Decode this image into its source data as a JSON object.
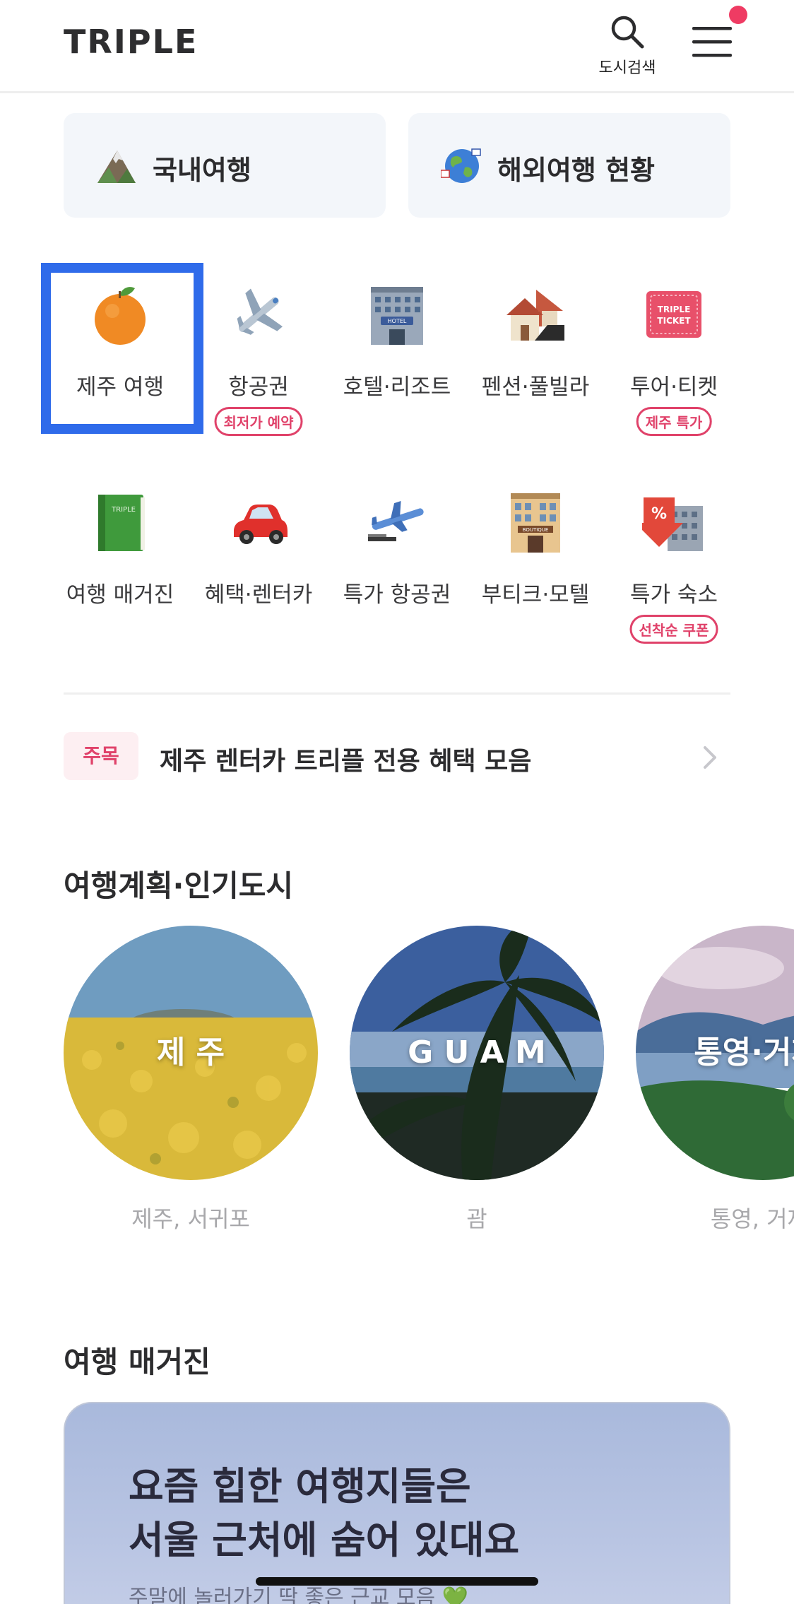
{
  "header": {
    "logo": "TRIPLE",
    "search_label": "도시검색",
    "menu_icon": "hamburger-menu-icon",
    "notification_color": "#ef3b63"
  },
  "top_cards": [
    {
      "label": "국내여행",
      "icon": "mountain-icon"
    },
    {
      "label": "해외여행 현황",
      "icon": "globe-icon"
    }
  ],
  "categories": [
    {
      "label": "제주 여행",
      "icon": "tangerine-icon",
      "selected": true
    },
    {
      "label": "항공권",
      "icon": "airplane-icon",
      "badge": "최저가 예약"
    },
    {
      "label": "호텔·리조트",
      "icon": "hotel-icon"
    },
    {
      "label": "펜션·풀빌라",
      "icon": "houses-icon"
    },
    {
      "label": "투어·티켓",
      "icon": "ticket-icon",
      "badge": "제주 특가"
    },
    {
      "label": "여행 매거진",
      "icon": "magazine-book-icon"
    },
    {
      "label": "혜택·렌터카",
      "icon": "car-icon"
    },
    {
      "label": "특가 항공권",
      "icon": "airplane-departure-icon"
    },
    {
      "label": "부티크·모텔",
      "icon": "boutique-building-icon"
    },
    {
      "label": "특가 숙소",
      "icon": "discount-building-icon",
      "badge": "선착순 쿠폰"
    }
  ],
  "notice": {
    "tag": "주목",
    "text": "제주 렌터카 트리플 전용 혜택 모음"
  },
  "popular_cities": {
    "title": "여행계획·인기도시",
    "items": [
      {
        "title": "제 주",
        "subtitle": "제주, 서귀포"
      },
      {
        "title": "G U A M",
        "subtitle": "괌"
      },
      {
        "title": "통영·거제·",
        "subtitle": "통영, 거제,"
      }
    ]
  },
  "magazine": {
    "title": "여행 매거진",
    "card_title": "요즘 힙한 여행지들은\n서울 근처에 숨어 있대요",
    "card_subtitle": "주말에 놀러가기 딱 좋은 근교 모음 💚"
  },
  "colors": {
    "accent_pink": "#e0426a",
    "focus_blue": "#2f6bea"
  }
}
